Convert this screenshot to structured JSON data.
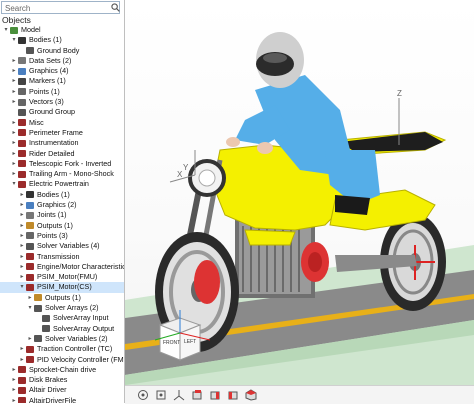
{
  "search": {
    "placeholder": "Search"
  },
  "objects_label": "Objects",
  "tree": [
    {
      "label": "Model",
      "depth": 0,
      "exp": "▾",
      "icon": "model-icon",
      "color": "#4a8f3c"
    },
    {
      "label": "Bodies (1)",
      "depth": 1,
      "exp": "▾",
      "icon": "bodies-icon",
      "color": "#333333"
    },
    {
      "label": "Ground Body",
      "depth": 2,
      "exp": "",
      "icon": "ground-icon",
      "color": "#555555"
    },
    {
      "label": "Data Sets (2)",
      "depth": 1,
      "exp": "▸",
      "icon": "datasets-icon",
      "color": "#777777"
    },
    {
      "label": "Graphics (4)",
      "depth": 1,
      "exp": "▸",
      "icon": "graphics-icon",
      "color": "#4a7fc0"
    },
    {
      "label": "Markers (1)",
      "depth": 1,
      "exp": "▸",
      "icon": "markers-icon",
      "color": "#444444"
    },
    {
      "label": "Points (1)",
      "depth": 1,
      "exp": "▸",
      "icon": "points-icon",
      "color": "#666666"
    },
    {
      "label": "Vectors (3)",
      "depth": 1,
      "exp": "▸",
      "icon": "vectors-icon",
      "color": "#666666"
    },
    {
      "label": "Ground Group",
      "depth": 1,
      "exp": "",
      "icon": "group-icon",
      "color": "#555555"
    },
    {
      "label": "Misc",
      "depth": 1,
      "exp": "▸",
      "icon": "system-icon",
      "color": "#9b2b2b"
    },
    {
      "label": "Perimeter Frame",
      "depth": 1,
      "exp": "▸",
      "icon": "system-icon",
      "color": "#9b2b2b"
    },
    {
      "label": "Instrumentation",
      "depth": 1,
      "exp": "▸",
      "icon": "system-icon",
      "color": "#9b2b2b"
    },
    {
      "label": "Rider Detailed",
      "depth": 1,
      "exp": "▸",
      "icon": "system-icon",
      "color": "#9b2b2b"
    },
    {
      "label": "Telescopic Fork - Inverted",
      "depth": 1,
      "exp": "▸",
      "icon": "system-icon",
      "color": "#9b2b2b"
    },
    {
      "label": "Trailing Arm - Mono-Shock",
      "depth": 1,
      "exp": "▸",
      "icon": "system-icon",
      "color": "#9b2b2b"
    },
    {
      "label": "Electric Powertrain",
      "depth": 1,
      "exp": "▾",
      "icon": "system-icon",
      "color": "#9b2b2b"
    },
    {
      "label": "Bodies (1)",
      "depth": 2,
      "exp": "▸",
      "icon": "bodies-icon",
      "color": "#333333"
    },
    {
      "label": "Graphics (2)",
      "depth": 2,
      "exp": "▸",
      "icon": "graphics-icon",
      "color": "#4a7fc0"
    },
    {
      "label": "Joints (1)",
      "depth": 2,
      "exp": "▸",
      "icon": "joints-icon",
      "color": "#777777"
    },
    {
      "label": "Outputs (1)",
      "depth": 2,
      "exp": "▸",
      "icon": "outputs-icon",
      "color": "#c08a2a"
    },
    {
      "label": "Points (3)",
      "depth": 2,
      "exp": "▸",
      "icon": "points-icon",
      "color": "#666666"
    },
    {
      "label": "Solver Variables (4)",
      "depth": 2,
      "exp": "▸",
      "icon": "solvervar-icon",
      "color": "#555555"
    },
    {
      "label": "Transmission",
      "depth": 2,
      "exp": "▸",
      "icon": "system-icon",
      "color": "#9b2b2b"
    },
    {
      "label": "Engine/Motor Characteristics",
      "depth": 2,
      "exp": "▸",
      "icon": "system-icon",
      "color": "#9b2b2b"
    },
    {
      "label": "PSIM_Motor(FMU)",
      "depth": 2,
      "exp": "▸",
      "icon": "system-icon",
      "color": "#9b2b2b"
    },
    {
      "label": "PSIM_Motor(CS)",
      "depth": 2,
      "exp": "▾",
      "icon": "system-icon",
      "color": "#9b2b2b",
      "selected": true
    },
    {
      "label": "Outputs (1)",
      "depth": 3,
      "exp": "▸",
      "icon": "outputs-icon",
      "color": "#c08a2a"
    },
    {
      "label": "Solver Arrays (2)",
      "depth": 3,
      "exp": "▾",
      "icon": "solverarray-icon",
      "color": "#555555"
    },
    {
      "label": "SolverArray Input",
      "depth": 4,
      "exp": "",
      "icon": "solverarray-icon",
      "color": "#555555"
    },
    {
      "label": "SolverArray Output",
      "depth": 4,
      "exp": "",
      "icon": "solverarray-icon",
      "color": "#555555"
    },
    {
      "label": "Solver Variables (2)",
      "depth": 3,
      "exp": "▸",
      "icon": "solvervar-icon",
      "color": "#555555"
    },
    {
      "label": "Traction Controller (TC)",
      "depth": 2,
      "exp": "▸",
      "icon": "system-icon",
      "color": "#9b2b2b"
    },
    {
      "label": "PID Velocity Controller (FMU)",
      "depth": 2,
      "exp": "▸",
      "icon": "system-icon",
      "color": "#9b2b2b"
    },
    {
      "label": "Sprocket-Chain drive",
      "depth": 1,
      "exp": "▸",
      "icon": "system-icon",
      "color": "#9b2b2b"
    },
    {
      "label": "Disk Brakes",
      "depth": 1,
      "exp": "▸",
      "icon": "system-icon",
      "color": "#9b2b2b"
    },
    {
      "label": "Altair Driver",
      "depth": 1,
      "exp": "▸",
      "icon": "system-icon",
      "color": "#9b2b2b"
    },
    {
      "label": "AltairDriverFile",
      "depth": 1,
      "exp": "▸",
      "icon": "system-icon",
      "color": "#9b2b2b"
    }
  ],
  "viewcube": {
    "front": "FRONT",
    "left": "LEFT"
  },
  "axes": {
    "z": "Z",
    "x": "X",
    "y": "Y"
  },
  "toolbar": [
    "view-orientation-icon",
    "fit-icon",
    "axis-triad-icon",
    "front-view-icon",
    "side-view-icon",
    "right-view-icon",
    "iso-view-icon"
  ],
  "colors": {
    "selection": "#cfe5fb",
    "fairing": "#f4f000",
    "rider_suit": "#55aee8",
    "road": "#8a8a8a",
    "road_line": "#e8b018",
    "ground_plane": "#cfe6cf"
  }
}
